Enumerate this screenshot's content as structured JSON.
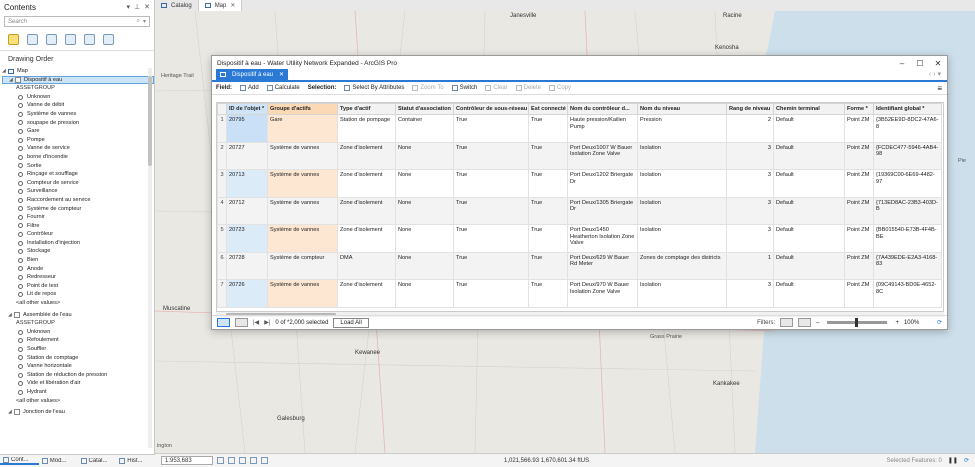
{
  "contents": {
    "title": "Contents",
    "search_placeholder": "Search",
    "drawing_order": "Drawing Order",
    "map_node": "Map",
    "layers": [
      {
        "name": "Dispositif à eau",
        "group": "ASSETGROUP",
        "items": [
          "Unknown",
          "Vanne de débit",
          "Système de vannes",
          "soupape de pression",
          "Gare",
          "Pompe",
          "Vanne de service",
          "borne d'incendie",
          "Sortie",
          "Rinçage et soufflage",
          "Compteur de service",
          "Surveillance",
          "Raccordement au service",
          "Système de compteur",
          "Fournir",
          "Filtre",
          "Contrôleur",
          "Installation d'injection",
          "Stockage",
          "Bien",
          "Anode",
          "Redresseur",
          "Point de test",
          "Lit de repos"
        ],
        "other": "<all other values>"
      },
      {
        "name": "Assemblée de l'eau",
        "group": "ASSETGROUP",
        "items": [
          "Unknown",
          "Refoulement",
          "Souffler",
          "Station de comptage",
          "Vanne horizontale",
          "Station de réduction de pression",
          "Vide et libération d'air",
          "Hydrant"
        ],
        "other": "<all other values>"
      },
      {
        "name": "Jonction de l'eau"
      }
    ]
  },
  "bottom_tabs": [
    "Cont...",
    "Mod...",
    "Catal...",
    "Hist..."
  ],
  "view_tabs": [
    {
      "label": "Catalog",
      "active": false
    },
    {
      "label": "Map",
      "active": true
    }
  ],
  "map_labels": [
    "Janesville",
    "Racine",
    "Kenosha",
    "Heritage Trail",
    "Muscatine",
    "Kewanee",
    "Grass Prairie",
    "Kankakee",
    "Galesburg",
    "ington",
    "Pie"
  ],
  "status": {
    "scale": "1:953,683",
    "coords": "1,021,566.93 1,670,601.34 ftUS",
    "selected_features": "Selected Features: 0"
  },
  "attr_window": {
    "title": "Dispositif à eau - Water Utility Network Expanded - ArcGIS Pro",
    "tab_label": "Dispositif à eau",
    "toolbar": {
      "field_label": "Field:",
      "add": "Add",
      "calculate": "Calculate",
      "selection_label": "Selection:",
      "select_by_attributes": "Select By Attributes",
      "zoom_to": "Zoom To",
      "switch": "Switch",
      "clear": "Clear",
      "delete": "Delete",
      "copy": "Copy"
    },
    "columns": [
      "ID de l'objet *",
      "Groupe d'actifs",
      "Type d'actif",
      "Statut d'association",
      "Contrôleur de sous-réseau",
      "Est connecté",
      "Nom du contrôleur d...",
      "Nom du niveau",
      "Rang de niveau",
      "Chemin terminal",
      "Forme *",
      "Identifiant global *"
    ],
    "rows": [
      {
        "n": "1",
        "id": "20795",
        "grp": "Gare",
        "type": "Station de pompage",
        "assoc": "Container",
        "ctrl": "True",
        "conn": "True",
        "cname": "Haute pression/Kailien Pump",
        "lvl": "Pression",
        "rank": "2",
        "path": "Default",
        "shape": "Point ZM",
        "gid": "{3B52EE9D-8DC2-47A6-8"
      },
      {
        "n": "2",
        "id": "20727",
        "grp": "Système de vannes",
        "type": "Zone d'isolement",
        "assoc": "None",
        "ctrl": "True",
        "conn": "True",
        "cname": "Port Deux/1007 W Bauer Isolation Zone Valve",
        "lvl": "Isolation",
        "rank": "3",
        "path": "Default",
        "shape": "Point ZM",
        "gid": "{FCDEC477-5946-4AB4-98"
      },
      {
        "n": "3",
        "id": "20713",
        "grp": "Système de vannes",
        "type": "Zone d'isolement",
        "assoc": "None",
        "ctrl": "True",
        "conn": "True",
        "cname": "Port Deux/1202 Briergate Dr",
        "lvl": "Isolation",
        "rank": "3",
        "path": "Default",
        "shape": "Point ZM",
        "gid": "{19369C00-6E69-4482-97"
      },
      {
        "n": "4",
        "id": "20712",
        "grp": "Système de vannes",
        "type": "Zone d'isolement",
        "assoc": "None",
        "ctrl": "True",
        "conn": "True",
        "cname": "Port Deux/1305 Briergate Dr",
        "lvl": "Isolation",
        "rank": "3",
        "path": "Default",
        "shape": "Point ZM",
        "gid": "{713ED8AC-23B3-403D-B"
      },
      {
        "n": "5",
        "id": "20723",
        "grp": "Système de vannes",
        "type": "Zone d'isolement",
        "assoc": "None",
        "ctrl": "True",
        "conn": "True",
        "cname": "Port Deux/1450 Heatherton Isolation Zone Valve",
        "lvl": "Isolation",
        "rank": "3",
        "path": "Default",
        "shape": "Point ZM",
        "gid": "{BB015540-E73B-4F4B-BE"
      },
      {
        "n": "6",
        "id": "20728",
        "grp": "Système de compteur",
        "type": "DMA",
        "assoc": "None",
        "ctrl": "True",
        "conn": "True",
        "cname": "Port Deux/629 W Bauer Rd Meter",
        "lvl": "Zones de comptage des districts",
        "rank": "1",
        "path": "Default",
        "shape": "Point ZM",
        "gid": "{7A439EDE-E2A3-4168-83"
      },
      {
        "n": "7",
        "id": "20726",
        "grp": "Système de vannes",
        "type": "Zone d'isolement",
        "assoc": "None",
        "ctrl": "True",
        "conn": "True",
        "cname": "Port Deux/970 W Bauer Isolation Zone Valve",
        "lvl": "Isolation",
        "rank": "3",
        "path": "Default",
        "shape": "Point ZM",
        "gid": "{09C49143-BD0E-4652-8C"
      }
    ],
    "footer": {
      "selected": "0 of *2,000 selected",
      "load_all": "Load All",
      "filters": "Filters:",
      "zoom": "100%"
    }
  }
}
